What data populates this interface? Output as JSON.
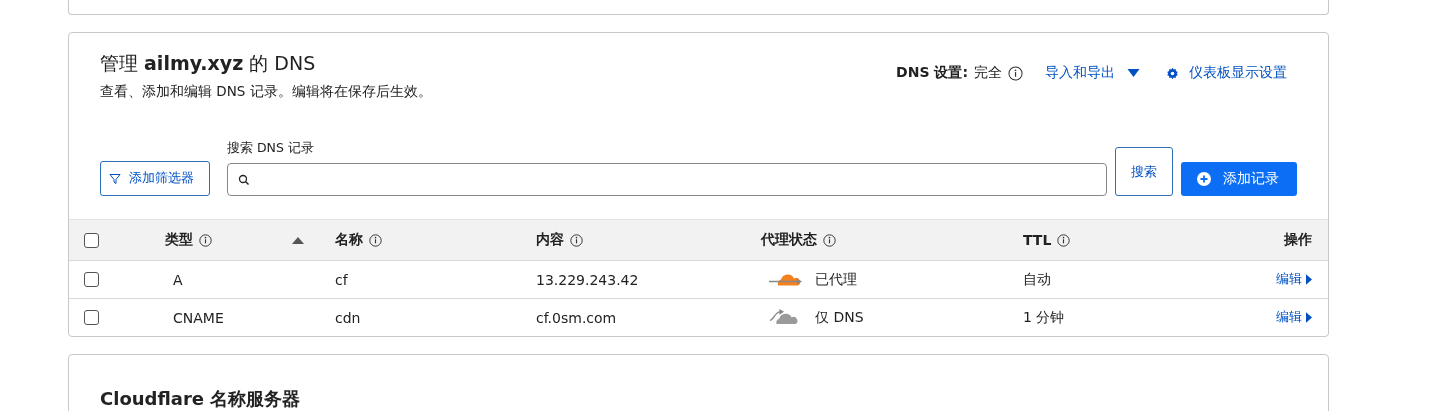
{
  "header": {
    "title": "管理 **ailmy.xyz** 的 DNS",
    "subtitle": "查看、添加和编辑 DNS 记录。编辑将在保存后生效。",
    "dns_setting_label": "DNS 设置:",
    "dns_setting_value": "完全",
    "import_export": "导入和导出",
    "dashboard_settings": "仪表板显示设置"
  },
  "toolbar": {
    "filter_button": "添加筛选器",
    "search_label": "搜索 DNS 记录",
    "search_button": "搜索",
    "add_button": "添加记录"
  },
  "table": {
    "all_checked": false,
    "columns": [
      {
        "label": "类型",
        "info": true,
        "sorted": true
      },
      {
        "label": "名称",
        "info": true,
        "sorted": false
      },
      {
        "label": "内容",
        "info": true,
        "sorted": false
      },
      {
        "label": "代理状态",
        "info": true,
        "sorted": false
      },
      {
        "label": "TTL",
        "info": true,
        "sorted": false
      },
      {
        "label": "操作",
        "info": false,
        "sorted": false
      }
    ],
    "rows": [
      {
        "checked": false,
        "type": "A",
        "name": "cf",
        "content": "13.229.243.42",
        "proxied": true,
        "proxy_status": "已代理",
        "ttl": "自动",
        "action": "编辑"
      },
      {
        "checked": false,
        "type": "CNAME",
        "name": "cdn",
        "content": "cf.0sm.com",
        "proxied": false,
        "proxy_status": "仅 DNS",
        "ttl": "1 分钟",
        "action": "编辑"
      }
    ]
  },
  "nameservers": {
    "title": "Cloudflare 名称服务器"
  }
}
